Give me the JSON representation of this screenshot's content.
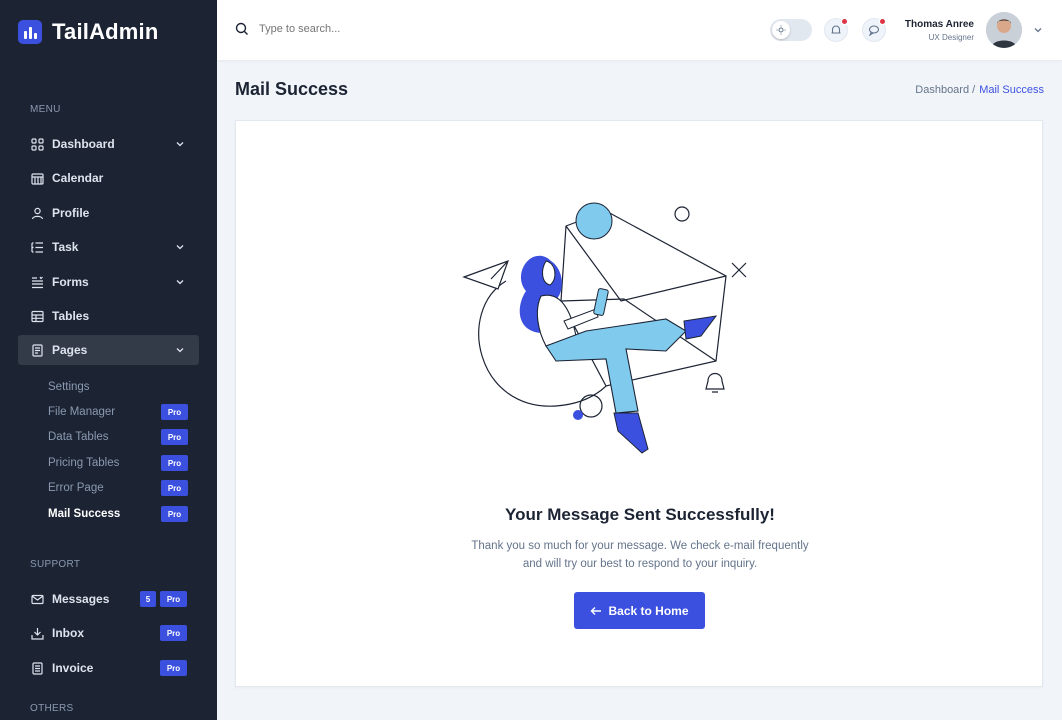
{
  "app": {
    "name": "TailAdmin"
  },
  "sidebar": {
    "menu_title": "MENU",
    "items": [
      {
        "label": "Dashboard"
      },
      {
        "label": "Calendar"
      },
      {
        "label": "Profile"
      },
      {
        "label": "Task"
      },
      {
        "label": "Forms"
      },
      {
        "label": "Tables"
      },
      {
        "label": "Pages"
      }
    ],
    "pages_sub": [
      {
        "label": "Settings"
      },
      {
        "label": "File Manager",
        "badge": "Pro"
      },
      {
        "label": "Data Tables",
        "badge": "Pro"
      },
      {
        "label": "Pricing Tables",
        "badge": "Pro"
      },
      {
        "label": "Error Page",
        "badge": "Pro"
      },
      {
        "label": "Mail Success",
        "badge": "Pro"
      }
    ],
    "support_title": "SUPPORT",
    "support_items": [
      {
        "label": "Messages",
        "count": "5",
        "badge": "Pro"
      },
      {
        "label": "Inbox",
        "badge": "Pro"
      },
      {
        "label": "Invoice",
        "badge": "Pro"
      }
    ],
    "others_title": "OTHERS"
  },
  "header": {
    "search_placeholder": "Type to search...",
    "user_name": "Thomas Anree",
    "user_role": "UX Designer"
  },
  "page": {
    "title": "Mail Success",
    "breadcrumb_home": "Dashboard /",
    "breadcrumb_current": "Mail Success"
  },
  "content": {
    "heading": "Your Message Sent Successfully!",
    "line1": "Thank you so much for your message. We check e-mail frequently",
    "line2": "and will try our best to respond to your inquiry.",
    "button_label": "Back to Home"
  },
  "colors": {
    "primary": "#3C50E0",
    "sidebar_bg": "#1C2434",
    "illustration_light": "#80CAEE",
    "notification_dot": "#DC3545"
  }
}
